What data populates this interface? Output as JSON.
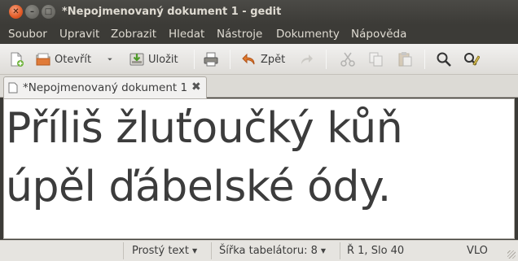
{
  "window": {
    "title": "*Nepojmenovaný dokument 1 - gedit",
    "close_glyph": "✕",
    "minimize_glyph": "–",
    "maximize_glyph": "□"
  },
  "menu": [
    "Soubor",
    "Upravit",
    "Zobrazit",
    "Hledat",
    "Nástroje",
    "Dokumenty",
    "Nápověda"
  ],
  "toolbar": {
    "open_label": "Otevřít",
    "save_label": "Uložit",
    "undo_label": "Zpět",
    "icons": [
      "new-document-icon",
      "open-folder-icon",
      "dropdown-arrow-icon",
      "save-icon",
      "print-icon",
      "undo-icon",
      "redo-icon",
      "cut-icon",
      "copy-icon",
      "paste-icon",
      "search-icon",
      "search-replace-icon"
    ]
  },
  "tab": {
    "label": "*Nepojmenovaný dokument 1",
    "close_glyph": "✖"
  },
  "editor": {
    "lines": [
      "Příliš žluťoučký kůň",
      "úpěl ďábelské ódy."
    ]
  },
  "status": {
    "language": "Prostý text",
    "tab_width": "Šířka tabelátoru:  8",
    "position": "Ř 1, Slo 40",
    "mode": "VLO"
  },
  "colors": {
    "titlebar": "#3c3b37",
    "close_button": "#e25a26",
    "toolbar": "#f2f1f0",
    "editor_bg": "#ffffff",
    "text": "#3c3c3c"
  }
}
